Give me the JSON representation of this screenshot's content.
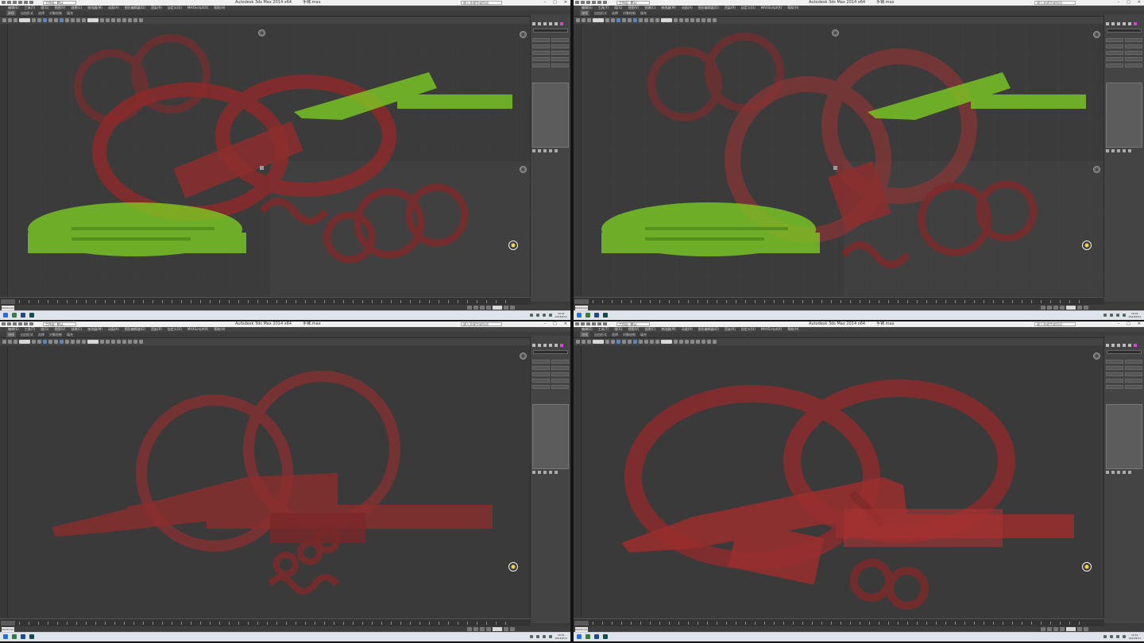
{
  "app": {
    "title": "Autodesk 3ds Max  2014 x64",
    "file": "手铐.max",
    "workspace": "工作区: 默认",
    "search_placeholder": "键入关键字或短语",
    "window_buttons": [
      "–",
      "□",
      "✕"
    ]
  },
  "menu": {
    "items": [
      "编辑(E)",
      "工具(T)",
      "组(G)",
      "视图(V)",
      "创建(C)",
      "修改器(M)",
      "动画(A)",
      "图形编辑器(D)",
      "渲染(R)",
      "自定义(U)",
      "MAXScript(X)",
      "帮助(H)"
    ]
  },
  "ribbon": {
    "tabs": [
      "建模",
      "自由形式",
      "选择",
      "对象绘制",
      "填充"
    ]
  },
  "status": {
    "maxscript_label": "MAXScript"
  },
  "taskbar": {
    "time": "16:01",
    "date": "2023/8/31"
  },
  "colors": {
    "cuff_red": "#b23a3a",
    "cuff_red_dark": "#6e2424",
    "cuff_green": "#7ed321",
    "viewport_bg": "#3b3b3b",
    "accent_magenta": "#e040e0"
  },
  "icons": [
    "viewcube-icon",
    "navigation-wheel-icon",
    "maximize-viewport-icon"
  ]
}
